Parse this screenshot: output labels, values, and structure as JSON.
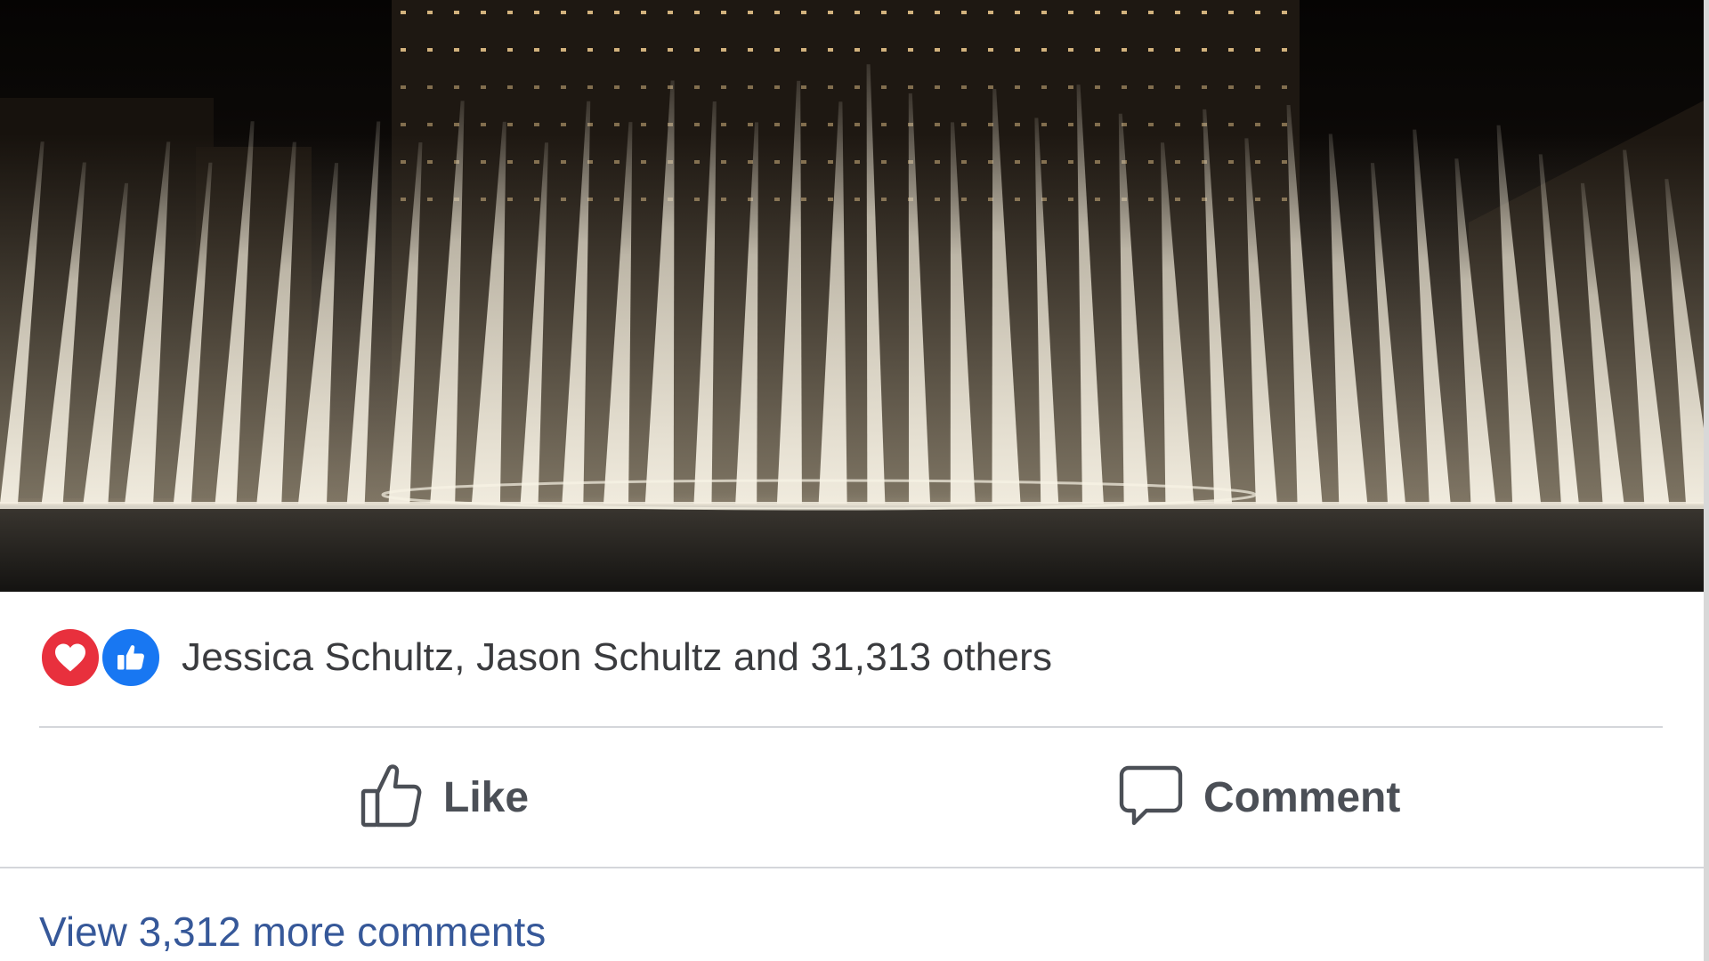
{
  "post": {
    "media": {
      "alt_icon": "fountain-video-frame"
    },
    "reactions": {
      "icons": [
        "heart-icon",
        "thumbs-up-icon"
      ],
      "summary": "Jessica Schultz, Jason Schultz and 31,313 others"
    },
    "actions": {
      "like_label": "Like",
      "comment_label": "Comment"
    },
    "comments": {
      "view_more_label": "View 3,312 more comments"
    }
  },
  "colors": {
    "love": "#e8303d",
    "like": "#1877f2",
    "link": "#365899",
    "text": "#3a3b3e"
  }
}
